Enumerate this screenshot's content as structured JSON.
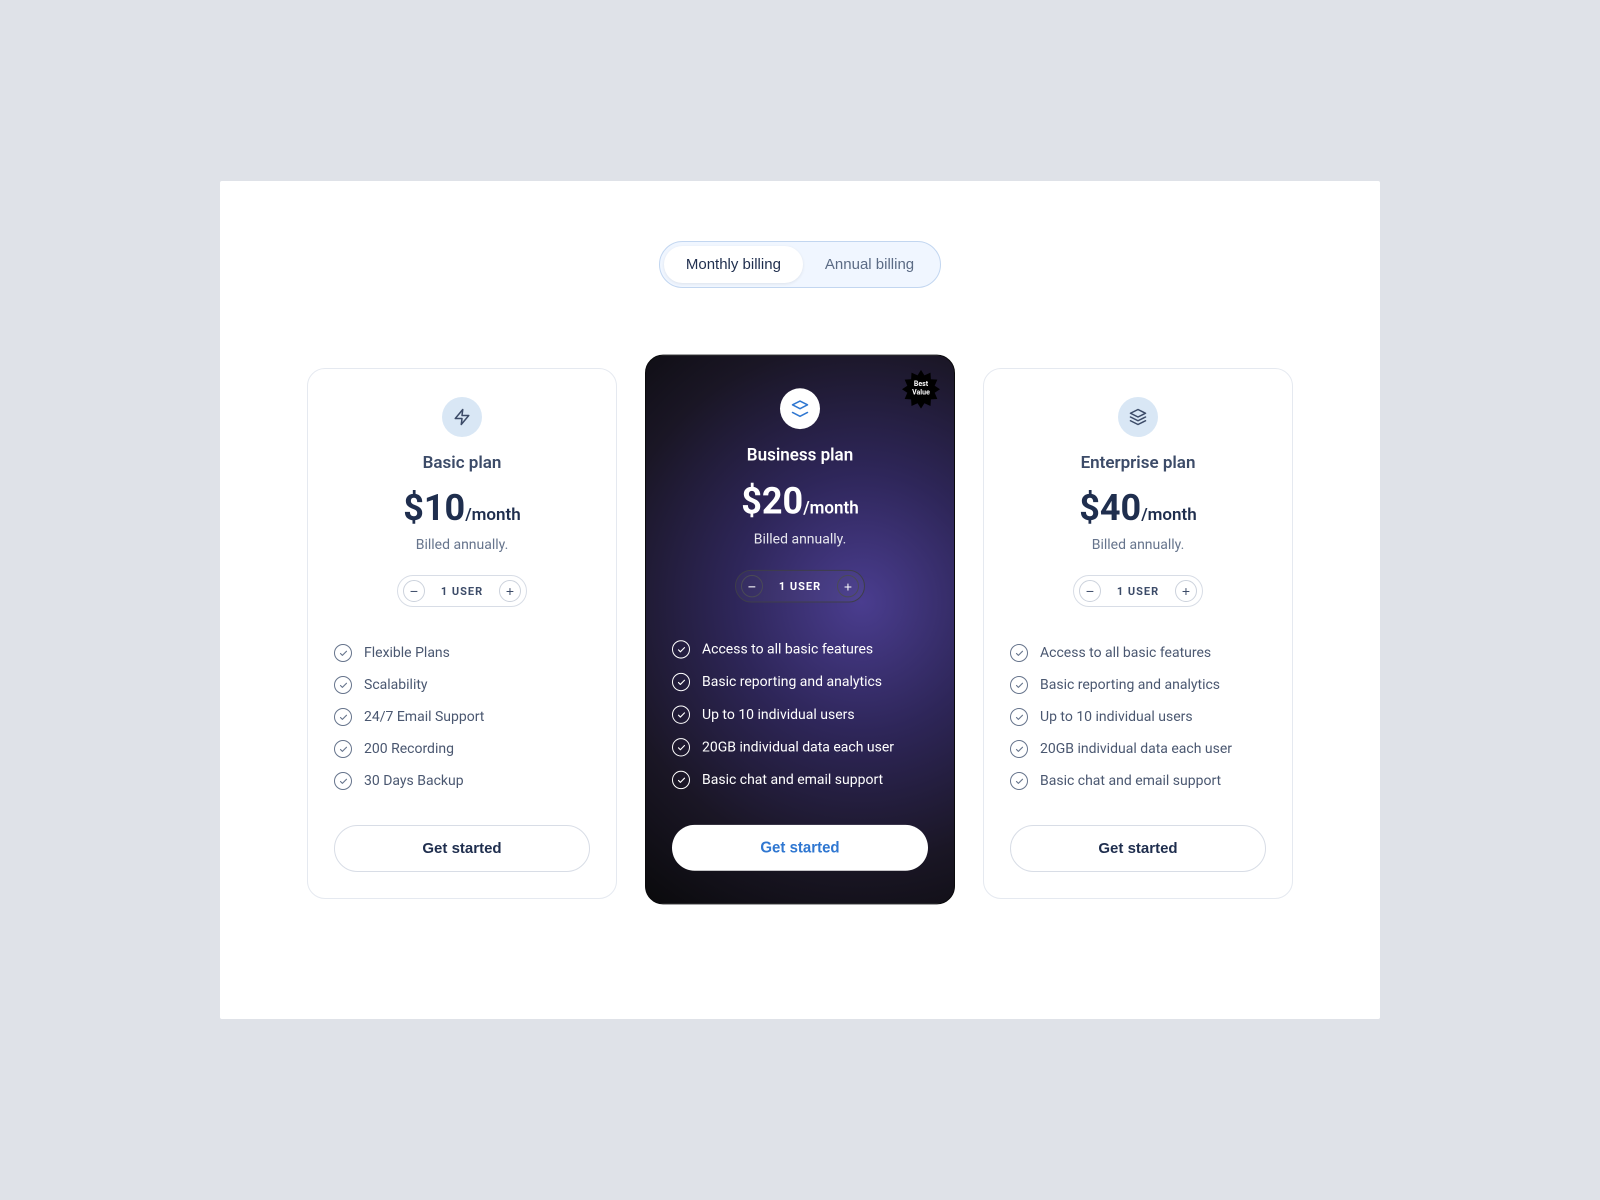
{
  "billing_toggle": {
    "monthly": "Monthly billing",
    "annual": "Annual billing"
  },
  "plans": [
    {
      "name": "Basic plan",
      "price": "$10",
      "period": "/month",
      "billing_note": "Billed annually.",
      "user_count": "1 USER",
      "cta": "Get started",
      "features": [
        "Flexible Plans",
        "Scalability",
        "24/7 Email Support",
        "200 Recording",
        "30 Days Backup"
      ]
    },
    {
      "name": "Business plan",
      "price": "$20",
      "period": "/month",
      "billing_note": "Billed annually.",
      "user_count": "1 USER",
      "cta": "Get started",
      "badge_line1": "Best",
      "badge_line2": "Value",
      "features": [
        "Access to all basic features",
        "Basic reporting and analytics",
        "Up to 10 individual users",
        "20GB individual data each user",
        "Basic chat and email support"
      ]
    },
    {
      "name": "Enterprise plan",
      "price": "$40",
      "period": "/month",
      "billing_note": "Billed annually.",
      "user_count": "1 USER",
      "cta": "Get started",
      "features": [
        "Access to all basic features",
        "Basic reporting and analytics",
        "Up to 10 individual users",
        "20GB individual data each user",
        "Basic chat and email support"
      ]
    }
  ]
}
